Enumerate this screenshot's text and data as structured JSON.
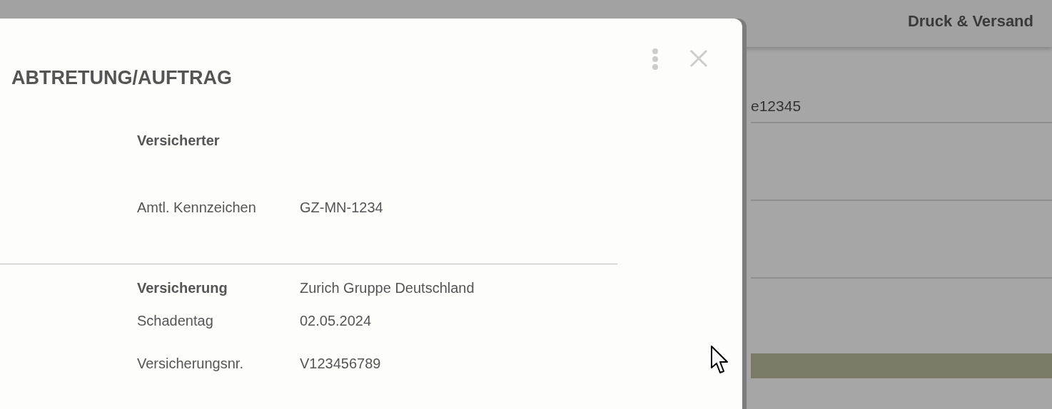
{
  "background": {
    "tab": "Druck & Versand",
    "field_value": "e12345"
  },
  "dialog": {
    "title": "ABTRETUNG/AUFTRAG",
    "sections": [
      {
        "rows": [
          {
            "label": "Versicherter",
            "bold": true
          },
          {
            "label": "Amtl. Kennzeichen",
            "value": "GZ-MN-1234",
            "bold": false
          }
        ]
      },
      {
        "rows": [
          {
            "label": "Versicherung",
            "value": "Zurich Gruppe Deutschland",
            "bold": true
          },
          {
            "label": "Schadentag",
            "value": "02.05.2024",
            "bold": false
          },
          {
            "label": "Versicherungsnr.",
            "value": "V123456789",
            "bold": false
          }
        ]
      }
    ]
  }
}
